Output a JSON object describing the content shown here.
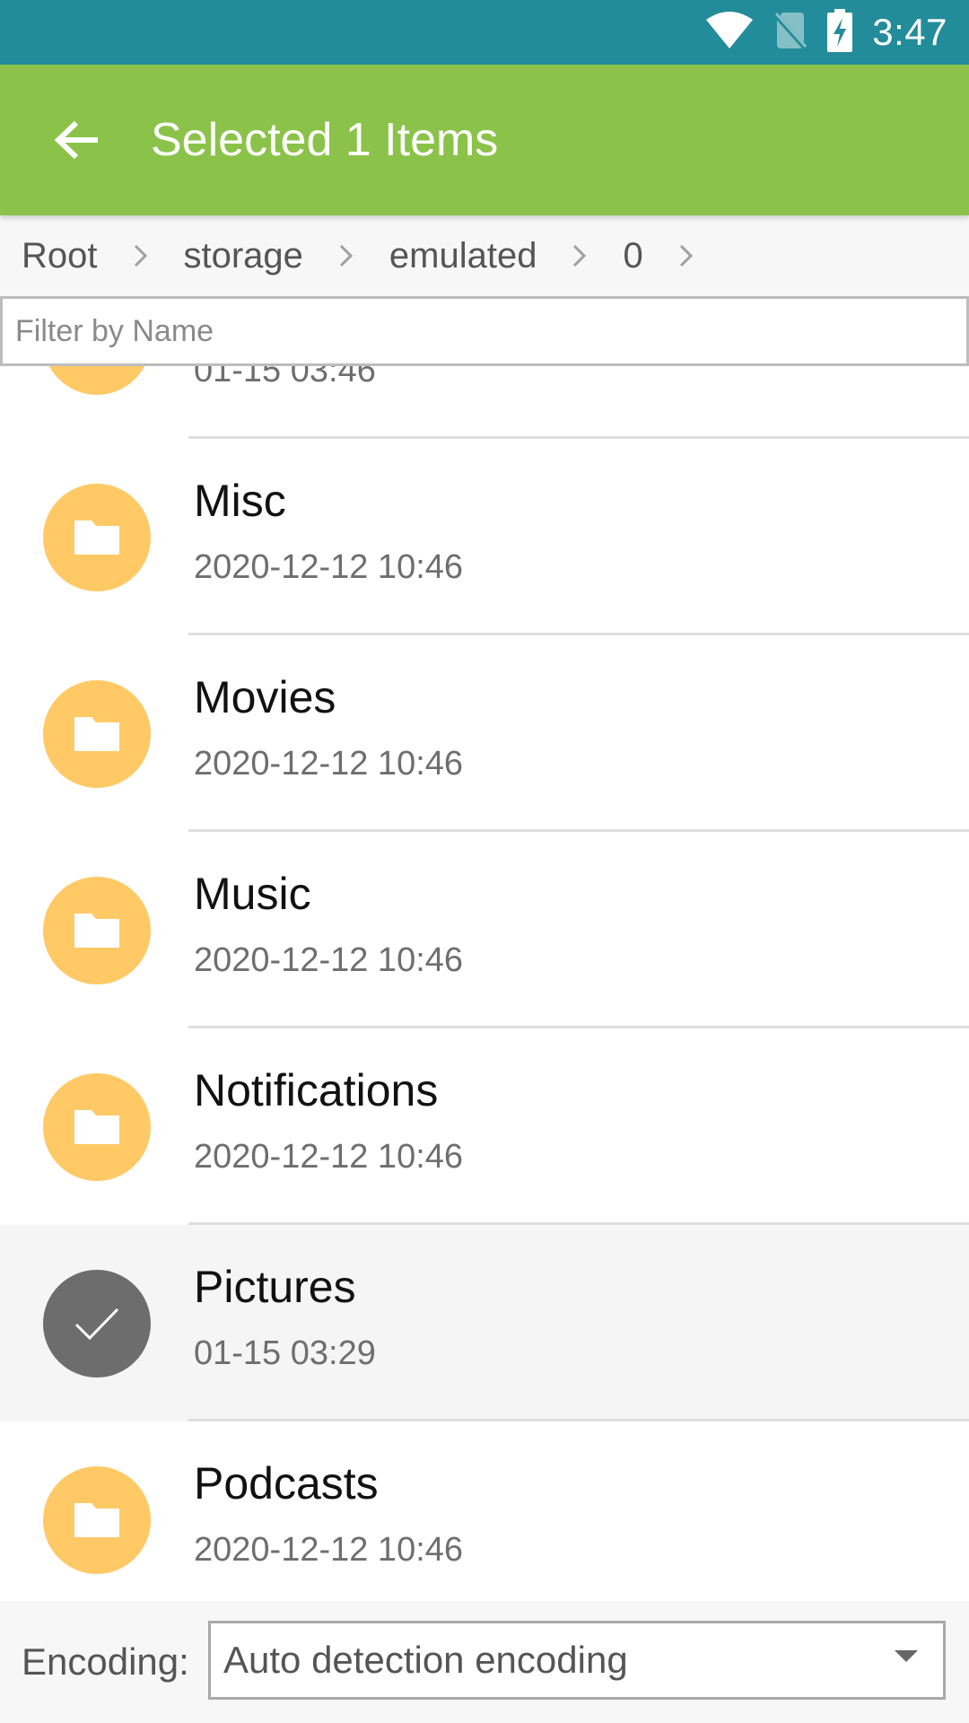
{
  "status_bar": {
    "time": "3:47",
    "icons": [
      "wifi-icon",
      "no-sim-icon",
      "battery-charging-icon"
    ],
    "background": "#238c9a"
  },
  "toolbar": {
    "back_icon": "arrow-back-icon",
    "title": "Selected 1 Items",
    "background": "#8bc34a"
  },
  "breadcrumb": [
    "Root",
    "storage",
    "emulated",
    "0"
  ],
  "filter": {
    "placeholder": "Filter by Name",
    "value": ""
  },
  "list": {
    "items": [
      {
        "name": "",
        "date": "01-15 03:46",
        "icon": "folder-icon",
        "selected": false
      },
      {
        "name": "Misc",
        "date": "2020-12-12 10:46",
        "icon": "folder-icon",
        "selected": false
      },
      {
        "name": "Movies",
        "date": "2020-12-12 10:46",
        "icon": "folder-icon",
        "selected": false
      },
      {
        "name": "Music",
        "date": "2020-12-12 10:46",
        "icon": "folder-icon",
        "selected": false
      },
      {
        "name": "Notifications",
        "date": "2020-12-12 10:46",
        "icon": "folder-icon",
        "selected": false
      },
      {
        "name": "Pictures",
        "date": "01-15 03:29",
        "icon": "check-icon",
        "selected": true
      },
      {
        "name": "Podcasts",
        "date": "2020-12-12 10:46",
        "icon": "folder-icon",
        "selected": false
      }
    ],
    "folder_color": "#ffc966",
    "selected_color": "#6d6d6d"
  },
  "encoding": {
    "label": "Encoding:",
    "value": "Auto detection encoding"
  }
}
